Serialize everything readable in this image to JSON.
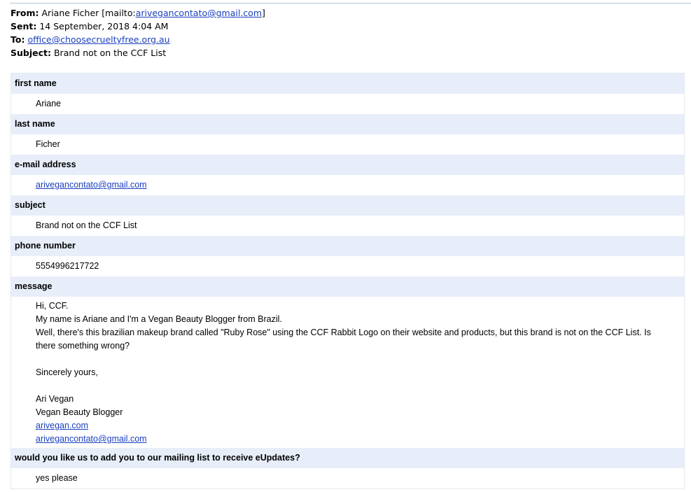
{
  "email_header": {
    "from_label": "From:",
    "from_name": "Ariane Ficher [mailto:",
    "from_email": "ariveganc​ontato@gmail.com",
    "from_close": "]",
    "sent_label": "Sent:",
    "sent_value": "14 September, 2018 4:04 AM",
    "to_label": "To:",
    "to_email": "office@choosecrueltyfree.org.au",
    "subject_label": "Subject:",
    "subject_value": "Brand not on the CCF List"
  },
  "form": {
    "first_name_label": "first name",
    "first_name_value": "Ariane",
    "last_name_label": "last name",
    "last_name_value": "Ficher",
    "email_label": "e-mail address",
    "email_value": "arivegancontato@gmail.com",
    "subject_label": "subject",
    "subject_value": "Brand not on the CCF List",
    "phone_label": "phone number",
    "phone_value": "5554996217722",
    "message_label": "message",
    "message": {
      "line1": "Hi, CCF.",
      "line2": "My name is Ariane and I'm a Vegan Beauty Blogger from Brazil.",
      "line3": "Well, there's this brazilian makeup brand called \"Ruby Rose\" using the CCF Rabbit Logo on their website and products, but this brand is not on the CCF List. Is there something wrong?",
      "line4": "Sincerely yours,",
      "line5": "Ari Vegan",
      "line6": "Vegan Beauty Blogger",
      "link1": "arivegan.com",
      "link2": "arivegancontato@gmail.com"
    },
    "mailing_label": "would you like us to add you to our mailing list to receive eUpdates?",
    "mailing_value": "yes please"
  }
}
